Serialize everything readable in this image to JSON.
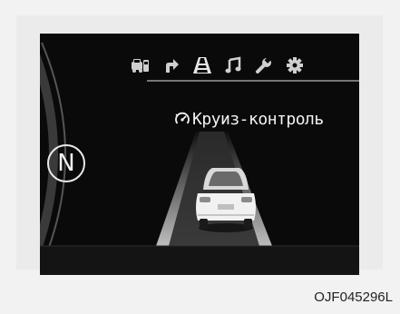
{
  "icons": [
    {
      "name": "fuel-car-icon",
      "active": false
    },
    {
      "name": "turn-arrow-icon",
      "active": false
    },
    {
      "name": "lane-road-icon",
      "active": true
    },
    {
      "name": "music-note-icon",
      "active": false
    },
    {
      "name": "wrench-icon",
      "active": false
    },
    {
      "name": "settings-gear-icon",
      "active": false
    }
  ],
  "mode_title": "Круиз-контроль",
  "mode_icon": "cruise-control-icon",
  "gear_indicator": "N",
  "figure_code": "OJF045296L",
  "colors": {
    "screen_bg": "#0a0a0a",
    "text": "#f2f2f2",
    "icon": "#cfcfcf",
    "page_bg": "#f2f2f2"
  }
}
